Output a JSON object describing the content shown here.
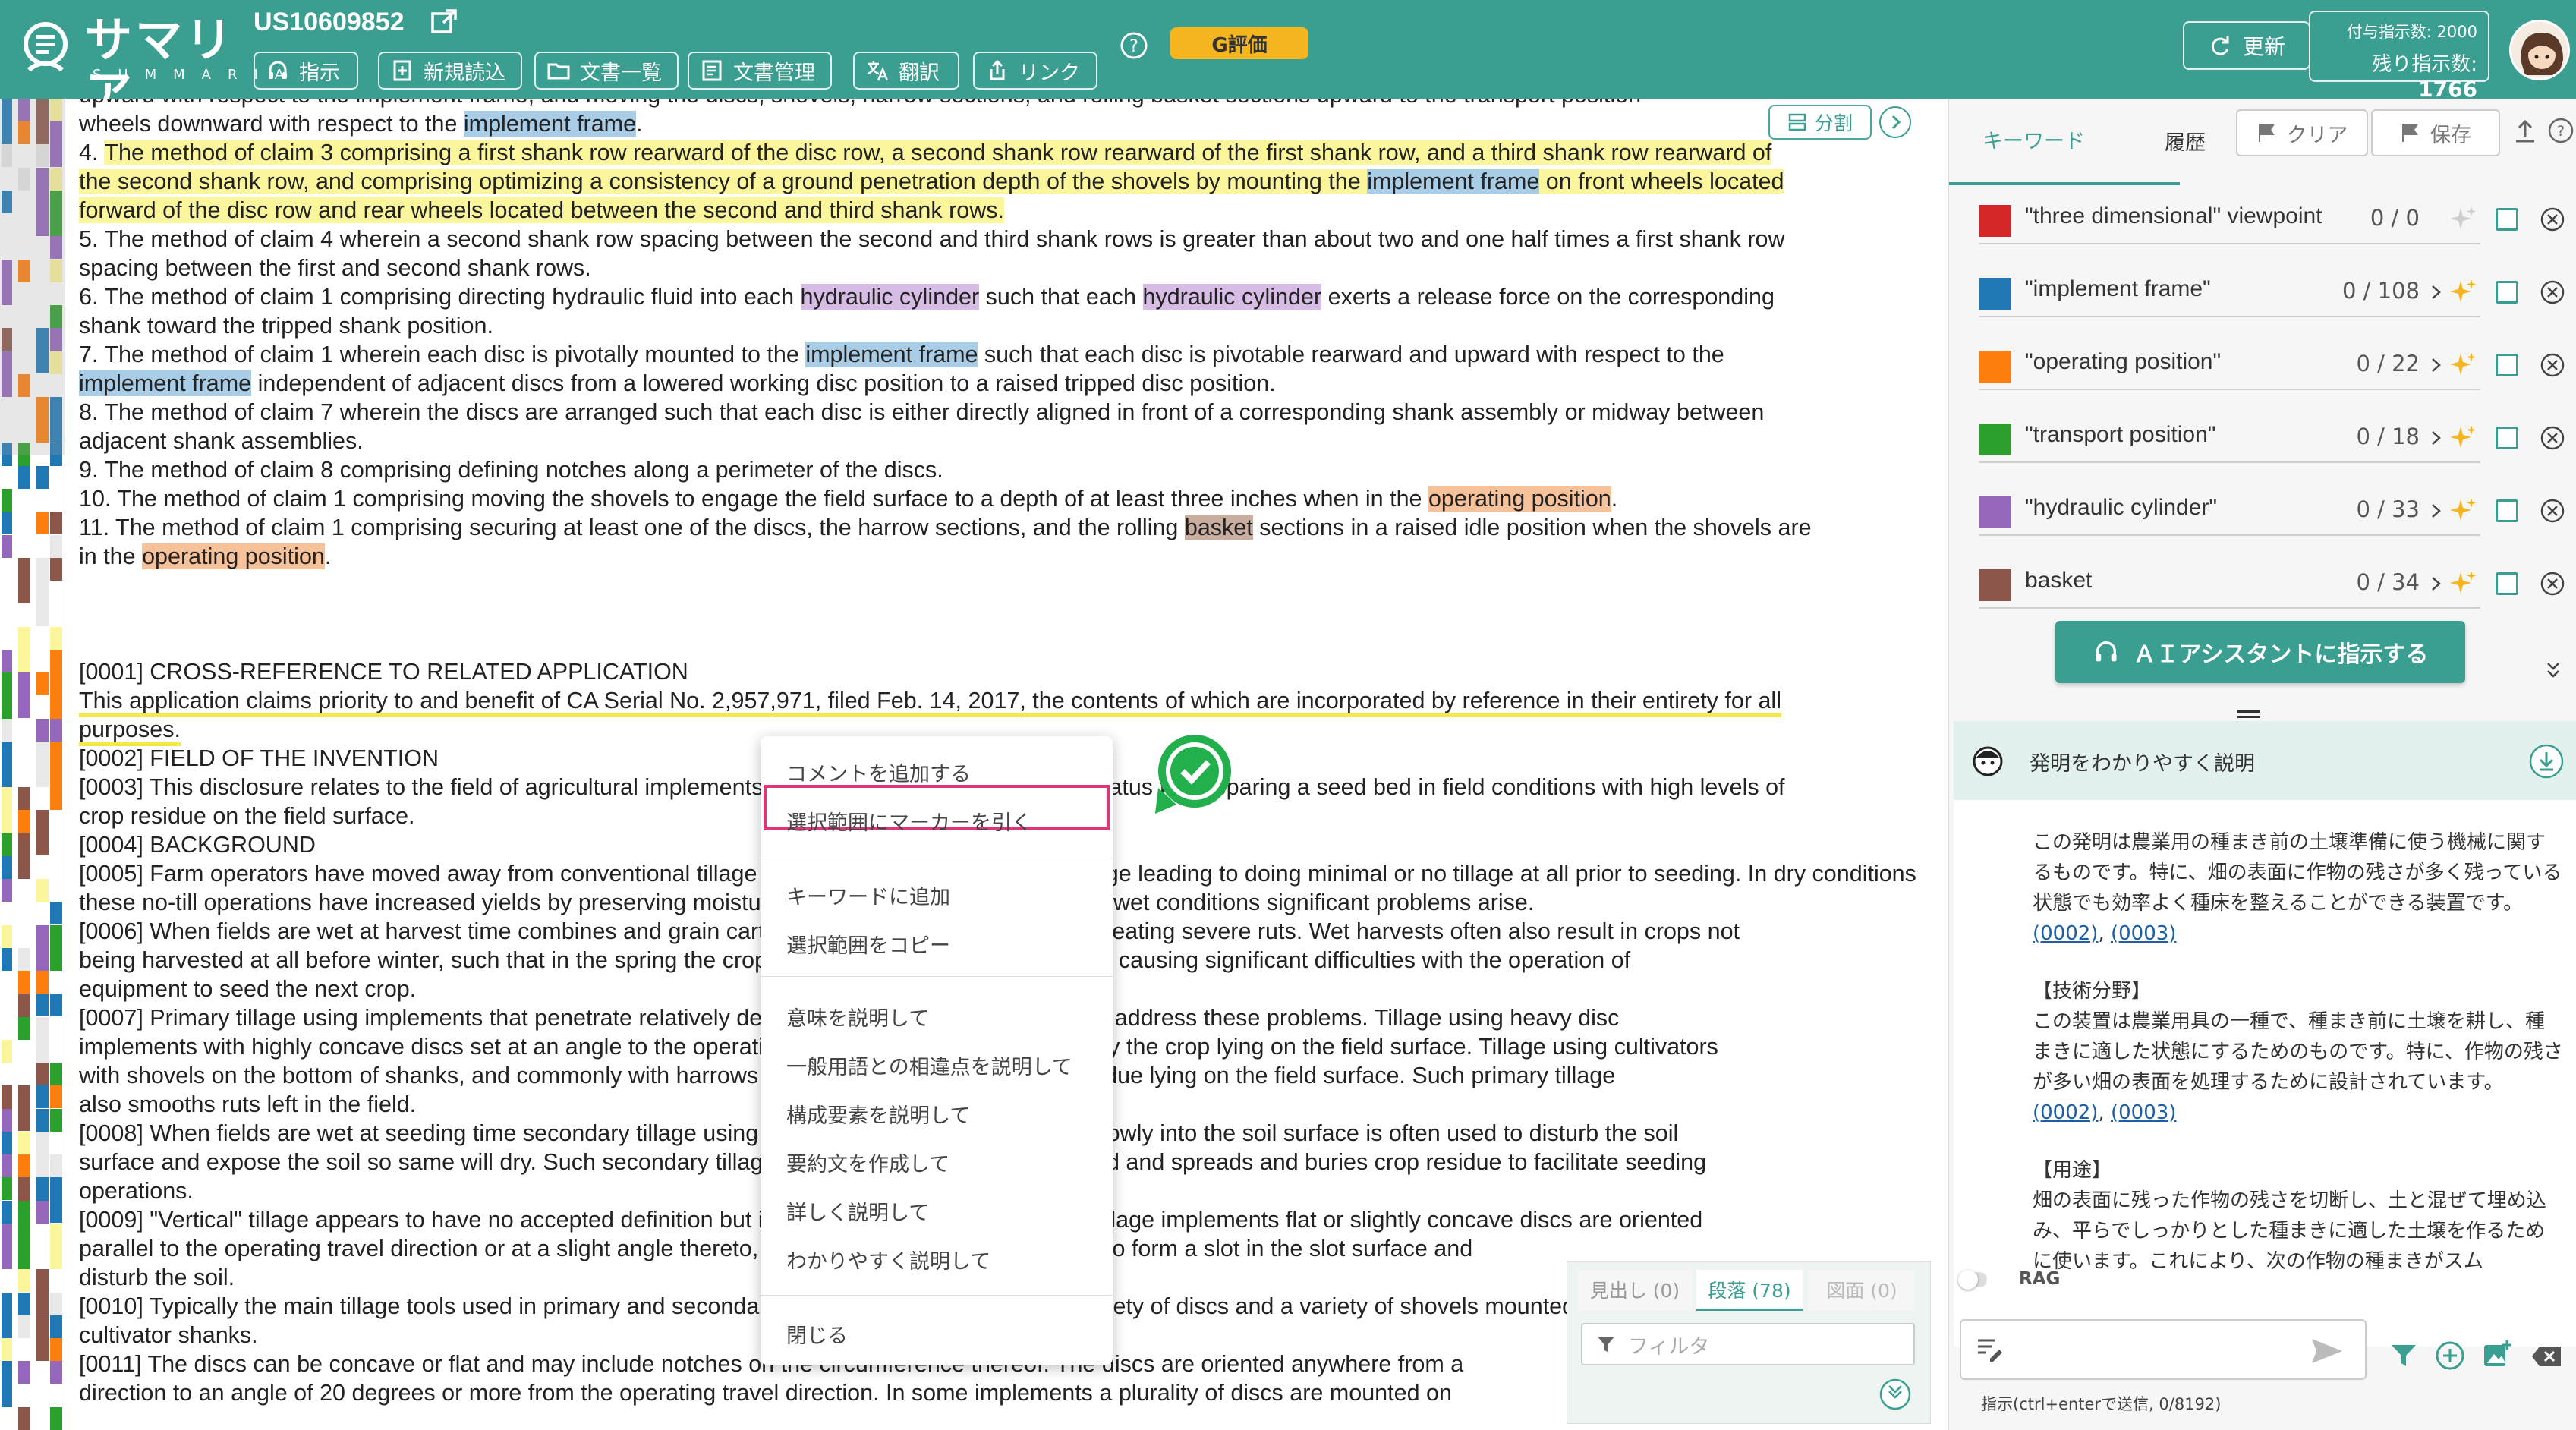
{
  "header": {
    "logo_jp": "サマリア",
    "logo_en": "SUMMARIA",
    "doc_id": "US10609852",
    "nav": [
      {
        "label": "指示",
        "icon": "headset-icon"
      },
      {
        "label": "新規読込",
        "icon": "add-doc-icon"
      },
      {
        "label": "文書一覧",
        "icon": "folder-icon"
      },
      {
        "label": "文書管理",
        "icon": "doc-manage-icon"
      },
      {
        "label": "翻訳",
        "icon": "translate-icon"
      },
      {
        "label": "リンク",
        "icon": "share-icon"
      }
    ],
    "grade_badge": "G評価",
    "refresh_label": "更新",
    "quota_granted": "付与指示数: 2000",
    "quota_remaining_label": "残り指示数: ",
    "quota_remaining_value": "1766"
  },
  "document": {
    "split_label": "分割",
    "lines": {
      "l0": "upward with respect to the implement frame, and moving the discs, shovels, harrow sections, and rolling basket sections upward to the transport position",
      "l1a": "wheels downward with respect to the ",
      "l1b": "implement frame",
      "l1c": ".",
      "c4a": "4. ",
      "c4b": "The method of claim 3 comprising a first shank row rearward of the disc row, a second shank row rearward of the first shank row, and a third shank row rearward of",
      "c4c": "the second shank row, and comprising optimizing a consistency of a ground penetration depth of the shovels by mounting the ",
      "c4d": "implement frame",
      "c4e": " on front wheels located",
      "c4f": "forward of the disc row and rear wheels located between the second and third shank rows.",
      "c5a": "5. The method of claim 4 wherein a second shank row spacing between the second and third shank rows is greater than about two and one half times a first shank row",
      "c5b": "spacing between the first and second shank rows.",
      "c6a": "6. The method of claim 1 comprising directing hydraulic fluid into each ",
      "c6b": "hydraulic cylinder",
      "c6c": " such that each ",
      "c6d": "hydraulic cylinder",
      "c6e": " exerts a release force on the corresponding",
      "c6f": "shank toward the tripped shank position.",
      "c7a": "7. The method of claim 1 wherein each disc is pivotally mounted to the ",
      "c7b": "implement frame",
      "c7c": " such that each disc is pivotable rearward and upward with respect to the",
      "c7d": "implement frame",
      "c7e": " independent of adjacent discs from a lowered working disc position to a raised tripped disc position.",
      "c8a": "8. The method of claim 7 wherein the discs are arranged such that each disc is either directly aligned in front of a corresponding shank assembly or midway between",
      "c8b": "adjacent shank assemblies.",
      "c9": "9. The method of claim 8 comprising defining notches along a perimeter of the discs.",
      "c10a": "10. The method of claim 1 comprising moving the shovels to engage the field surface to a depth of at least three inches when in the ",
      "c10b": "operating position",
      "c10c": ".",
      "c11a": "11. The method of claim 1 comprising securing at least one of the discs, the harrow sections, and the rolling ",
      "c11b": "basket",
      "c11c": " sections in a raised idle position when the shovels are",
      "c11d": "in the ",
      "c11e": "operating position",
      "c11f": ".",
      "p1": "[0001] CROSS-REFERENCE TO RELATED APPLICATION",
      "p1a": "This application claims priority to and benefit of CA Serial No. 2,957,971, filed Feb. 14, 2017, the contents of which are incorporated by reference in their entirety for all",
      "p1b": "purposes.",
      "p2": "[0002] FIELD OF THE INVENTION",
      "p3a": "[0003] This disclosure relates to the field of agricultural implements and more specifically to an apparatus for preparing a seed bed in field conditions with high levels of",
      "p3b": "crop residue on the field surface.",
      "p4": "[0004] BACKGROUND",
      "p5a": "[0005] Farm operators have moved away from conventional tillage practices in favor of minimum tillage leading to doing minimal or no tillage at all prior to seeding. In dry conditions",
      "p5b": "these no-till operations have increased yields by preserving moisture in the soil for crops, however in wet conditions significant problems arise.",
      "p6a": "[0006] When fields are wet at harvest time combines and grain carts create ruts in the field surface creating severe ruts. Wet harvests often also result in crops not",
      "p6b": "being harvested at all before winter, such that in the spring the crop residue is left on the field surface causing significant difficulties with the operation of",
      "p6c": "equipment to seed the next crop.",
      "p7a": "[0007] Primary tillage using implements that penetrate relatively deeply into the soil are often used to address these problems. Tillage using heavy disc",
      "p7b": "implements with highly concave discs set at an angle to the operating travel direction are used to bury the crop lying on the field surface. Tillage using cultivators",
      "p7c": "with shovels on the bottom of shanks, and commonly with harrows behind, bury the crop or crop residue lying on the field surface. Such primary tillage",
      "p7d": "also smooths ruts left in the field.",
      "p8a": "[0008] When fields are wet at seeding time secondary tillage using discs set at angles relatively shallowly into the soil surface is often used to disturb the soil",
      "p8b": "surface and expose the soil so same will dry. Such secondary tillage also levels the soil left in the field and spreads and buries crop residue to facilitate seeding",
      "p8c": "operations.",
      "p9a": "[0009] \"Vertical\" tillage appears to have no accepted definition but is generally practiced. In vertical tillage implements flat or slightly concave discs are oriented",
      "p9b": "parallel to the operating travel direction or at a slight angle thereto, and the discs cut into the ground to form a slot in the slot surface and",
      "p9c": "disturb the soil.",
      "p10a": "[0010] Typically the main tillage tools used in primary and secondary tillage implements include a variety of discs and a variety of shovels mounted on",
      "p10b": "cultivator shanks.",
      "p11a": "[0011] The discs can be concave or flat and may include notches on the circumference thereof. The discs are oriented anywhere from a",
      "p11b": "direction to an angle of 20 degrees or more from the operating travel direction. In some implements a plurality of discs are mounted on"
    }
  },
  "context_menu": {
    "items": [
      "コメントを追加する",
      "選択範囲にマーカーを引く",
      "キーワードに追加",
      "選択範囲をコピー",
      "意味を説明して",
      "一般用語との相違点を説明して",
      "構成要素を説明して",
      "要約文を作成して",
      "詳しく説明して",
      "わかりやすく説明して",
      "閉じる"
    ]
  },
  "right_panel": {
    "tabs": {
      "keywords": "キーワード",
      "history": "履歴"
    },
    "clear_label": "クリア",
    "save_label": "保存",
    "keywords": [
      {
        "label": "\"three dimensional\" viewpoint",
        "count": "0 / 0",
        "color": "#d62728"
      },
      {
        "label": "\"implement frame\"",
        "count": "0 / 108",
        "color": "#1f77b4"
      },
      {
        "label": "\"operating position\"",
        "count": "0 / 22",
        "color": "#ff7f0e"
      },
      {
        "label": "\"transport position\"",
        "count": "0 / 18",
        "color": "#2ca02c"
      },
      {
        "label": "\"hydraulic cylinder\"",
        "count": "0 / 33",
        "color": "#9467bd"
      },
      {
        "label": "basket",
        "count": "0 / 34",
        "color": "#8c564b"
      }
    ],
    "ai_button": "ＡＩアシスタントに指示する",
    "explain_title": "発明をわかりやすく説明",
    "explain": {
      "intro": "この発明は農業用の種まき前の土壌準備に使う機械に関するものです。特に、畑の表面に作物の残さが多く残っている状態でも効率よく種床を整えることができる装置です。",
      "intro_ref1": "(0002)",
      "intro_ref_sep": ", ",
      "intro_ref2": "(0003)",
      "h1": "【技術分野】",
      "t1": "この装置は農業用具の一種で、種まき前に土壌を耕し、種まきに適した状態にするためのものです。特に、作物の残さが多い畑の表面を処理するために設計されています。",
      "t1_ref1": "(0002)",
      "t1_ref2": "(0003)",
      "h2": "【用途】",
      "t2": "畑の表面に残った作物の残さを切断し、土と混ぜて埋め込み、平らでしっかりとした種まきに適した土壌を作るために使います。これにより、次の作物の種まきがスム"
    },
    "subtabs": [
      {
        "label": "見出し (0)"
      },
      {
        "label": "段落 (78)"
      },
      {
        "label": "図面 (0)"
      }
    ],
    "filter_placeholder": "フィルタ",
    "rag_label": "RAG",
    "prompt_hint": "指示(ctrl+enterで送信, 0/8192)"
  },
  "colors": {
    "brand": "#3a9e91",
    "badge": "#f4b51f",
    "menu_highlight": "#e0357a"
  }
}
